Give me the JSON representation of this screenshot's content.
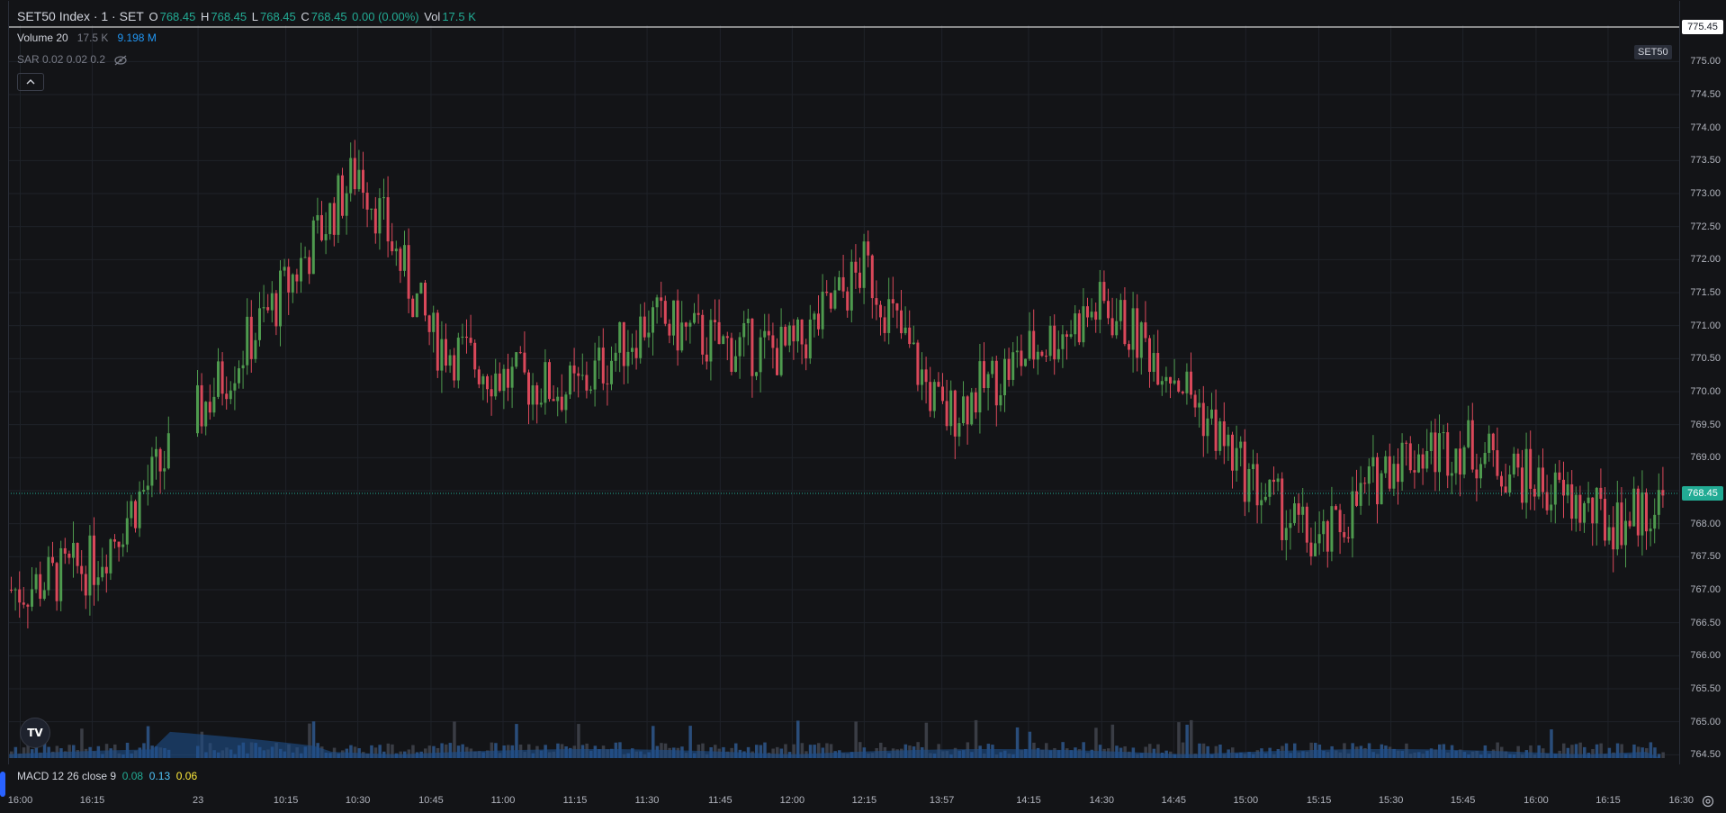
{
  "header": {
    "symbol": "SET50 Index · 1 · SET",
    "o_label": "O",
    "o_value": "768.45",
    "h_label": "H",
    "h_value": "768.45",
    "l_label": "L",
    "l_value": "768.45",
    "c_label": "C",
    "c_value": "768.45",
    "change": "0.00 (0.00%)",
    "vol_label": "Vol",
    "vol_value": "17.5 K"
  },
  "volume_indicator": {
    "label": "Volume 20",
    "value1": "17.5 K",
    "value2": "9.198 M"
  },
  "sar_indicator": {
    "label": "SAR 0.02 0.02 0.2",
    "visibility_icon": "eye-off-icon"
  },
  "collapse_icon": "chevron-up-icon",
  "symbol_badge": "SET50",
  "high_badge": "775.45",
  "last_price_badge": "768.45",
  "macd": {
    "label": "MACD 12 26 close 9",
    "v1": "0.08",
    "v2": "0.13",
    "v3": "0.06"
  },
  "logo": "TV",
  "colors": {
    "up": "#22ab94",
    "down": "#f23645",
    "up_candle": "#4e9a4e",
    "down_candle": "#d9485a",
    "volume": "#2962ff",
    "background": "#131417"
  },
  "price_axis": [
    "775.00",
    "774.50",
    "774.00",
    "773.50",
    "773.00",
    "772.50",
    "772.00",
    "771.50",
    "771.00",
    "770.50",
    "770.00",
    "769.50",
    "769.00",
    "768.50",
    "768.00",
    "767.50",
    "767.00",
    "766.50",
    "766.00",
    "765.50",
    "765.00",
    "764.50"
  ],
  "time_axis": [
    "16:00",
    "16:15",
    "23",
    "10:15",
    "10:30",
    "10:45",
    "11:00",
    "11:15",
    "11:30",
    "11:45",
    "12:00",
    "12:15",
    "13:57",
    "14:15",
    "14:30",
    "14:45",
    "15:00",
    "15:15",
    "15:30",
    "15:45",
    "16:00",
    "16:15",
    "16:30"
  ],
  "chart_data": {
    "type": "candlestick",
    "ylim": [
      764.45,
      775.55
    ],
    "session_anchors": [
      {
        "t": "16:00",
        "price": 767.0
      },
      {
        "t": "16:15",
        "price": 767.4
      },
      {
        "t": "10:15",
        "price": 771.6
      },
      {
        "t": "10:30",
        "price": 773.4
      },
      {
        "t": "10:45",
        "price": 770.8
      },
      {
        "t": "11:00",
        "price": 770.2
      },
      {
        "t": "11:15",
        "price": 770.0
      },
      {
        "t": "11:30",
        "price": 771.1
      },
      {
        "t": "11:45",
        "price": 770.7
      },
      {
        "t": "12:00",
        "price": 770.6
      },
      {
        "t": "12:15",
        "price": 771.9
      },
      {
        "t": "13:57",
        "price": 769.6
      },
      {
        "t": "14:15",
        "price": 770.6
      },
      {
        "t": "14:30",
        "price": 771.3
      },
      {
        "t": "14:45",
        "price": 770.3
      },
      {
        "t": "15:00",
        "price": 768.7
      },
      {
        "t": "15:15",
        "price": 767.6
      },
      {
        "t": "15:30",
        "price": 769.0
      },
      {
        "t": "15:45",
        "price": 769.2
      },
      {
        "t": "16:00",
        "price": 768.6
      },
      {
        "t": "16:15",
        "price": 768.0
      },
      {
        "t": "16:30",
        "price": 768.45
      }
    ]
  }
}
